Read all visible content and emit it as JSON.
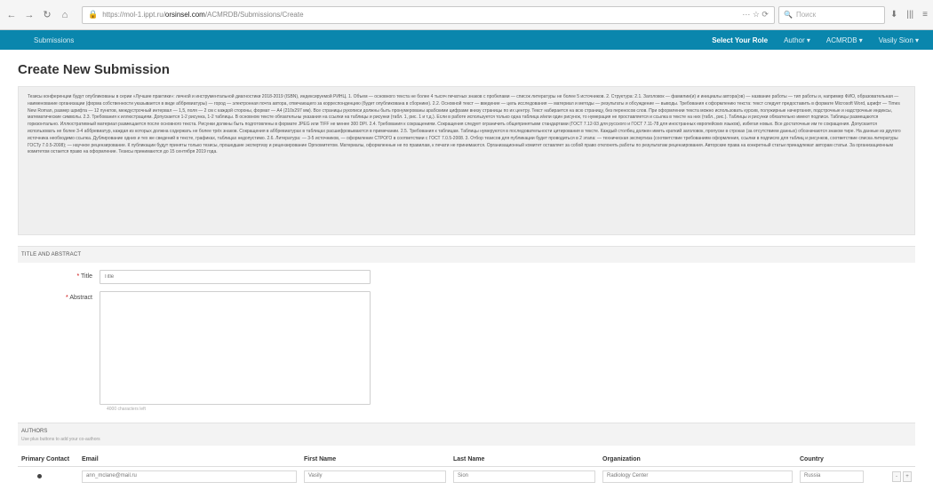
{
  "browser": {
    "back": "←",
    "forward": "→",
    "reload": "↻",
    "home": "⌂",
    "url_prefix": "https://mol-1.ippt.ru/",
    "url_domain": "orsinsel.com",
    "url_path": "/ACMRDB/Submissions/Create",
    "url_tools": "··· ☆ ⟳",
    "search_placeholder": "Поиск",
    "right_icons": [
      "⬇",
      "|||",
      "≡"
    ]
  },
  "navbar": {
    "brand": "Submissions",
    "role_label": "Select Your Role",
    "items": [
      "Author ▾",
      "ACMRDB ▾",
      "Vasily Sion ▾"
    ]
  },
  "page": {
    "title": "Create New Submission",
    "notice": "Тезисы конференции будут опубликованы в серии «Лучшие практики»: личной и инструментальной диагностики 2018-2019 (ISBN), индексируемой РИНЦ. 1. Объем — основного текста не более 4 тысяч печатных знаков с пробелами — список литературы не более 5 источников. 2. Структура: 2.1. Заголовок — фамилии(и) и инициалы автора(ов) — название работы — тип работы и, например ФИО, образовательная — наименование организации (форма собственности указывается в виде аббревиатуры) — город — электронная почта автора, отвечающего за корреспонденцию (будет опубликована в сборнике). 2.2. Основной текст — введение — цель исследования — материал и методы — результаты и обсуждение — выводы. Требования к оформлению текста: текст следует предоставить в формате Microsoft Word, шрифт — Times New Roman, размер шрифта — 12 пунктов, междустрочный интервал — 1,5, поля — 2 см с каждой стороны, формат — А4 (210х297 мм). Все страницы рукописи должны быть пронумерованы арабскими цифрами внизу страницы по их центру. Текст набирается на всю страницу, без переносов слов. При оформлении текста можно использовать курсив, полужирные начертания, подстрочные и надстрочные индексы, математические символы. 2.3. Требования к иллюстрациям. Допускается 1-2 рисунка, 1-2 таблицы. В основном тексте обязательны указания на ссылки на таблицы и рисунки (табл. 1, рис. 1 и т.д.). Если в работе используется только одна таблица и/или один рисунок, то нумерация не проставляется и ссылка в тексте на них (табл., рис.). Таблицы и рисунки обязательно имеют подписи. Таблицы размещаются горизонтально. Иллюстративный материал размещается после основного текста. Рисунки должны быть подготовлены в формате JPEG или TIFF не менее 300 DPI. 2.4. Требования к сокращениям. Сокращения следует ограничить общепринятыми стандартами (ГОСТ 7.12-93 для русского и ГОСТ 7.11-78 для иностранных европейских языков), избегая новых. Все достаточные им те сокращения. Допускается использовать не более 3-4 аббревиатур, каждая из которых должна содержать не более трёх знаков. Сокращения в аббревиатурах в таблицах расшифровываются в примечании. 2.5. Требования к таблицам. Таблицы нумеруются в последовательности цитирования в тексте. Каждый столбец должен иметь краткий заголовок, пропуски в строках (за отсутствием данных) обозначаются знаком тире. На данные из другого источника необходимо ссылка. Дублирование одних и тех же сведений в тексте, графиках, таблицах недопустимо. 2.6. Литература: — 3-5 источников, — оформление СТРОГО в соответствии с ГОСТ 7.0.5-2008. 3. Отбор тезисов для публикации будет проводиться в 2 этапа: — техническая экспертиза (соответствие требованиям оформления, ссылки в подписях для таблиц и рисунков, соответствие списка литературы ГОСТу 7.0.5-2008); — научное рецензирование. К публикации будут приняты только тезисы, прошедшие экспертизу и рецензирование Оргкомитетом. Материалы, оформленные не по правилам, к печати не принимаются. Организационный комитет оставляет за собой право отклонять работы по результатам рецензирования. Авторские права на конкретный статьи принадлежат авторам статьи. За организационным комитетом остается право на оформление. Тезисы принимаются до 15 сентября 2019 года."
  },
  "title_abstract": {
    "section_label": "TITLE AND ABSTRACT",
    "title_label": "Title",
    "title_placeholder": "Title",
    "abstract_label": "Abstract",
    "abstract_value": "",
    "abstract_helper": "4000 characters left"
  },
  "authors": {
    "section_label": "AUTHORS",
    "section_sub": "Use plus buttons to add your co-authors",
    "columns": [
      "Primary Contact",
      "Email",
      "First Name",
      "Last Name",
      "Organization",
      "Country"
    ],
    "rows": [
      {
        "email": "ann_mclane@mail.ru",
        "first_name": "Vasily",
        "last_name": "Sion",
        "organization": "Radiology Center",
        "country": "Russia"
      }
    ],
    "row_buttons": [
      "-",
      "+"
    ]
  }
}
